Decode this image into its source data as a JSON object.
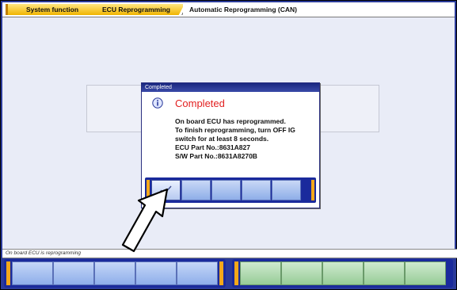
{
  "breadcrumb": {
    "items": [
      "System function",
      "ECU Reprogramming",
      "Automatic Reprogramming (CAN)"
    ]
  },
  "dialog": {
    "title": "Completed",
    "heading": "Completed",
    "body": "On board ECU has reprogrammed.\nTo finish reprogramming, turn OFF IG\nswitch for at least 8 seconds.\nECU Part No.:8631A827\nS/W Part No.:8631A8270B",
    "icon": "info-icon",
    "confirm_icon": "checkmark-icon"
  },
  "status": {
    "text": "On board ECU is reprogramming"
  },
  "colors": {
    "accent": "#f0b400",
    "frame": "#2a3a9a",
    "heading": "#e22020"
  }
}
